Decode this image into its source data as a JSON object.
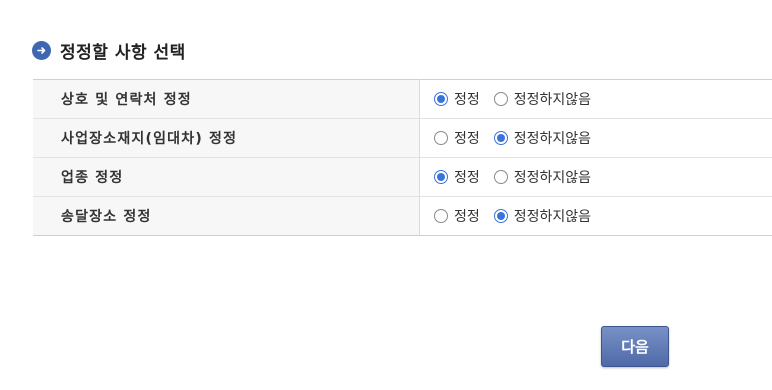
{
  "section": {
    "title": "정정할 사항 선택",
    "icon": "arrow-right-circle-icon",
    "accent_color": "#3f66b0"
  },
  "rows": [
    {
      "label": "상호 및 연락처 정정",
      "options": [
        {
          "label": "정정",
          "checked": true
        },
        {
          "label": "정정하지않음",
          "checked": false
        }
      ]
    },
    {
      "label": "사업장소재지(임대차) 정정",
      "options": [
        {
          "label": "정정",
          "checked": false
        },
        {
          "label": "정정하지않음",
          "checked": true
        }
      ]
    },
    {
      "label": "업종 정정",
      "options": [
        {
          "label": "정정",
          "checked": true
        },
        {
          "label": "정정하지않음",
          "checked": false
        }
      ]
    },
    {
      "label": "송달장소 정정",
      "options": [
        {
          "label": "정정",
          "checked": false
        },
        {
          "label": "정정하지않음",
          "checked": true
        }
      ]
    }
  ],
  "next_button": {
    "label": "다음",
    "color": "#5a74b0"
  },
  "radio_color": "#3b74d9"
}
